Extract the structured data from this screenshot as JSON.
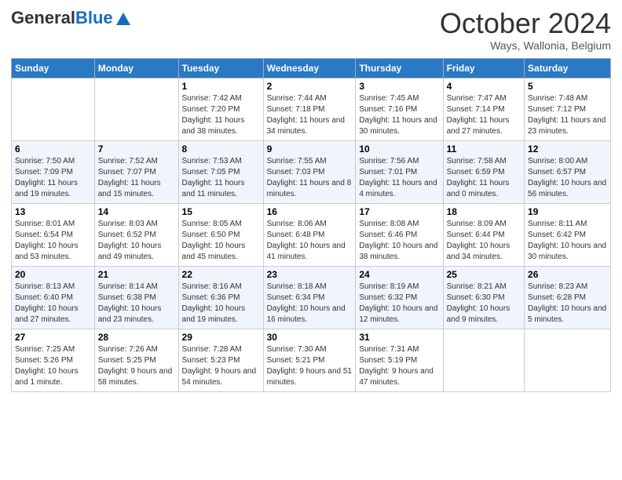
{
  "header": {
    "logo_general": "General",
    "logo_blue": "Blue",
    "month": "October 2024",
    "location": "Ways, Wallonia, Belgium"
  },
  "days_of_week": [
    "Sunday",
    "Monday",
    "Tuesday",
    "Wednesday",
    "Thursday",
    "Friday",
    "Saturday"
  ],
  "weeks": [
    [
      {
        "day": "",
        "sunrise": "",
        "sunset": "",
        "daylight": ""
      },
      {
        "day": "",
        "sunrise": "",
        "sunset": "",
        "daylight": ""
      },
      {
        "day": "1",
        "sunrise": "Sunrise: 7:42 AM",
        "sunset": "Sunset: 7:20 PM",
        "daylight": "Daylight: 11 hours and 38 minutes."
      },
      {
        "day": "2",
        "sunrise": "Sunrise: 7:44 AM",
        "sunset": "Sunset: 7:18 PM",
        "daylight": "Daylight: 11 hours and 34 minutes."
      },
      {
        "day": "3",
        "sunrise": "Sunrise: 7:45 AM",
        "sunset": "Sunset: 7:16 PM",
        "daylight": "Daylight: 11 hours and 30 minutes."
      },
      {
        "day": "4",
        "sunrise": "Sunrise: 7:47 AM",
        "sunset": "Sunset: 7:14 PM",
        "daylight": "Daylight: 11 hours and 27 minutes."
      },
      {
        "day": "5",
        "sunrise": "Sunrise: 7:48 AM",
        "sunset": "Sunset: 7:12 PM",
        "daylight": "Daylight: 11 hours and 23 minutes."
      }
    ],
    [
      {
        "day": "6",
        "sunrise": "Sunrise: 7:50 AM",
        "sunset": "Sunset: 7:09 PM",
        "daylight": "Daylight: 11 hours and 19 minutes."
      },
      {
        "day": "7",
        "sunrise": "Sunrise: 7:52 AM",
        "sunset": "Sunset: 7:07 PM",
        "daylight": "Daylight: 11 hours and 15 minutes."
      },
      {
        "day": "8",
        "sunrise": "Sunrise: 7:53 AM",
        "sunset": "Sunset: 7:05 PM",
        "daylight": "Daylight: 11 hours and 11 minutes."
      },
      {
        "day": "9",
        "sunrise": "Sunrise: 7:55 AM",
        "sunset": "Sunset: 7:03 PM",
        "daylight": "Daylight: 11 hours and 8 minutes."
      },
      {
        "day": "10",
        "sunrise": "Sunrise: 7:56 AM",
        "sunset": "Sunset: 7:01 PM",
        "daylight": "Daylight: 11 hours and 4 minutes."
      },
      {
        "day": "11",
        "sunrise": "Sunrise: 7:58 AM",
        "sunset": "Sunset: 6:59 PM",
        "daylight": "Daylight: 11 hours and 0 minutes."
      },
      {
        "day": "12",
        "sunrise": "Sunrise: 8:00 AM",
        "sunset": "Sunset: 6:57 PM",
        "daylight": "Daylight: 10 hours and 56 minutes."
      }
    ],
    [
      {
        "day": "13",
        "sunrise": "Sunrise: 8:01 AM",
        "sunset": "Sunset: 6:54 PM",
        "daylight": "Daylight: 10 hours and 53 minutes."
      },
      {
        "day": "14",
        "sunrise": "Sunrise: 8:03 AM",
        "sunset": "Sunset: 6:52 PM",
        "daylight": "Daylight: 10 hours and 49 minutes."
      },
      {
        "day": "15",
        "sunrise": "Sunrise: 8:05 AM",
        "sunset": "Sunset: 6:50 PM",
        "daylight": "Daylight: 10 hours and 45 minutes."
      },
      {
        "day": "16",
        "sunrise": "Sunrise: 8:06 AM",
        "sunset": "Sunset: 6:48 PM",
        "daylight": "Daylight: 10 hours and 41 minutes."
      },
      {
        "day": "17",
        "sunrise": "Sunrise: 8:08 AM",
        "sunset": "Sunset: 6:46 PM",
        "daylight": "Daylight: 10 hours and 38 minutes."
      },
      {
        "day": "18",
        "sunrise": "Sunrise: 8:09 AM",
        "sunset": "Sunset: 6:44 PM",
        "daylight": "Daylight: 10 hours and 34 minutes."
      },
      {
        "day": "19",
        "sunrise": "Sunrise: 8:11 AM",
        "sunset": "Sunset: 6:42 PM",
        "daylight": "Daylight: 10 hours and 30 minutes."
      }
    ],
    [
      {
        "day": "20",
        "sunrise": "Sunrise: 8:13 AM",
        "sunset": "Sunset: 6:40 PM",
        "daylight": "Daylight: 10 hours and 27 minutes."
      },
      {
        "day": "21",
        "sunrise": "Sunrise: 8:14 AM",
        "sunset": "Sunset: 6:38 PM",
        "daylight": "Daylight: 10 hours and 23 minutes."
      },
      {
        "day": "22",
        "sunrise": "Sunrise: 8:16 AM",
        "sunset": "Sunset: 6:36 PM",
        "daylight": "Daylight: 10 hours and 19 minutes."
      },
      {
        "day": "23",
        "sunrise": "Sunrise: 8:18 AM",
        "sunset": "Sunset: 6:34 PM",
        "daylight": "Daylight: 10 hours and 16 minutes."
      },
      {
        "day": "24",
        "sunrise": "Sunrise: 8:19 AM",
        "sunset": "Sunset: 6:32 PM",
        "daylight": "Daylight: 10 hours and 12 minutes."
      },
      {
        "day": "25",
        "sunrise": "Sunrise: 8:21 AM",
        "sunset": "Sunset: 6:30 PM",
        "daylight": "Daylight: 10 hours and 9 minutes."
      },
      {
        "day": "26",
        "sunrise": "Sunrise: 8:23 AM",
        "sunset": "Sunset: 6:28 PM",
        "daylight": "Daylight: 10 hours and 5 minutes."
      }
    ],
    [
      {
        "day": "27",
        "sunrise": "Sunrise: 7:25 AM",
        "sunset": "Sunset: 5:26 PM",
        "daylight": "Daylight: 10 hours and 1 minute."
      },
      {
        "day": "28",
        "sunrise": "Sunrise: 7:26 AM",
        "sunset": "Sunset: 5:25 PM",
        "daylight": "Daylight: 9 hours and 58 minutes."
      },
      {
        "day": "29",
        "sunrise": "Sunrise: 7:28 AM",
        "sunset": "Sunset: 5:23 PM",
        "daylight": "Daylight: 9 hours and 54 minutes."
      },
      {
        "day": "30",
        "sunrise": "Sunrise: 7:30 AM",
        "sunset": "Sunset: 5:21 PM",
        "daylight": "Daylight: 9 hours and 51 minutes."
      },
      {
        "day": "31",
        "sunrise": "Sunrise: 7:31 AM",
        "sunset": "Sunset: 5:19 PM",
        "daylight": "Daylight: 9 hours and 47 minutes."
      },
      {
        "day": "",
        "sunrise": "",
        "sunset": "",
        "daylight": ""
      },
      {
        "day": "",
        "sunrise": "",
        "sunset": "",
        "daylight": ""
      }
    ]
  ]
}
